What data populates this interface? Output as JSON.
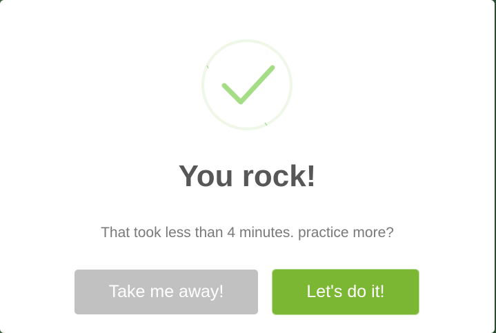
{
  "dialog": {
    "title": "You rock!",
    "message": "That took less than 4 minutes. practice more?",
    "cancel_label": "Take me away!",
    "confirm_label": "Let's do it!",
    "icon": "success-checkmark-icon"
  },
  "colors": {
    "backdrop": "#3a5f3f",
    "modal_background": "#ffffff",
    "title_text": "#575757",
    "message_text": "#797979",
    "icon_ring": "#eef7e8",
    "checkmark": "#a5dc86",
    "cancel_button": "#c1c1c1",
    "confirm_button": "#7cb733"
  }
}
